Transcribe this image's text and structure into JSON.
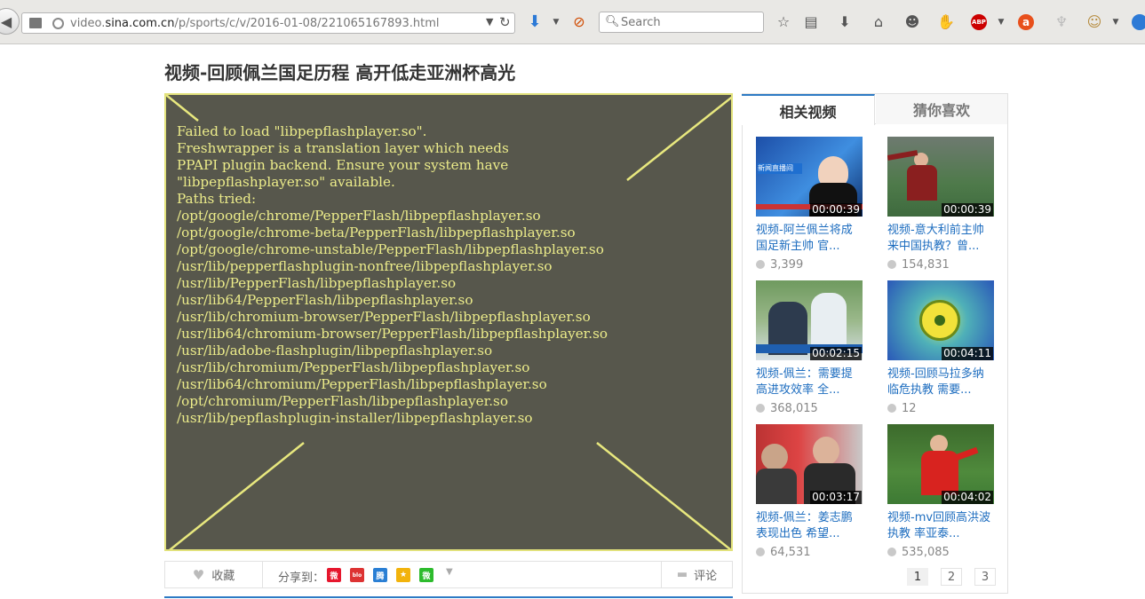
{
  "browser": {
    "url_host_prefix": "video.",
    "url_host_main": "sina.com.cn",
    "url_path": "/p/sports/c/v/2016-01-08/221065167893.html",
    "search_placeholder": "Search"
  },
  "page": {
    "title": "视频-回顾佩兰国足历程 高开低走亚洲杯高光"
  },
  "player": {
    "error_lines": [
      "Failed to load \"libpepflashplayer.so\".",
      "Freshwrapper is a translation layer which needs",
      "PPAPI plugin backend. Ensure your system have",
      "\"libpepflashplayer.so\" available.",
      "Paths tried:",
      "/opt/google/chrome/PepperFlash/libpepflashplayer.so",
      "/opt/google/chrome-beta/PepperFlash/libpepflashplayer.so",
      "/opt/google/chrome-unstable/PepperFlash/libpepflashplayer.so",
      "/usr/lib/pepperflashplugin-nonfree/libpepflashplayer.so",
      "/usr/lib/PepperFlash/libpepflashplayer.so",
      "/usr/lib64/PepperFlash/libpepflashplayer.so",
      "/usr/lib/chromium-browser/PepperFlash/libpepflashplayer.so",
      "/usr/lib64/chromium-browser/PepperFlash/libpepflashplayer.so",
      "/usr/lib/adobe-flashplugin/libpepflashplayer.so",
      "/usr/lib/chromium/PepperFlash/libpepflashplayer.so",
      "/usr/lib64/chromium/PepperFlash/libpepflashplayer.so",
      "/opt/chromium/PepperFlash/libpepflashplayer.so",
      "/usr/lib/pepflashplugin-installer/libpepflashplayer.so"
    ]
  },
  "actions": {
    "favorite_label": "收藏",
    "share_label": "分享到：",
    "share_targets": [
      {
        "name": "weibo",
        "glyph": "微",
        "color": "#e6162d"
      },
      {
        "name": "blog",
        "glyph": "blog",
        "color": "#d33"
      },
      {
        "name": "tencent-weibo",
        "glyph": "腾",
        "color": "#2a7fd4"
      },
      {
        "name": "qzone",
        "glyph": "★",
        "color": "#f2b30c"
      },
      {
        "name": "wechat",
        "glyph": "微",
        "color": "#2dbb2d"
      }
    ],
    "comment_label": "评论"
  },
  "sidebar": {
    "tabs": [
      {
        "label": "相关视频",
        "active": true
      },
      {
        "label": "猜你喜欢",
        "active": false
      }
    ],
    "videos": [
      {
        "title_line1": "视频-阿兰佩兰将成",
        "title_line2": "国足新主帅 官...",
        "duration": "00:00:39",
        "plays": "3,399",
        "thumb": "news"
      },
      {
        "title_line1": "视频-意大利前主帅",
        "title_line2": "来中国执教？曾...",
        "duration": "00:00:39",
        "plays": "154,831",
        "thumb": "coach"
      },
      {
        "title_line1": "视频-佩兰：需要提",
        "title_line2": "高进攻效率 全...",
        "duration": "00:02:15",
        "plays": "368,015",
        "thumb": "players"
      },
      {
        "title_line1": "视频-回顾马拉多纳",
        "title_line2": "临危执教 需要...",
        "duration": "00:04:11",
        "plays": "12",
        "thumb": "reel"
      },
      {
        "title_line1": "视频-佩兰：姜志鹏",
        "title_line2": "表现出色 希望...",
        "duration": "00:03:17",
        "plays": "64,531",
        "thumb": "interview"
      },
      {
        "title_line1": "视频-mv回顾高洪波",
        "title_line2": "执教 率亚泰...",
        "duration": "00:04:02",
        "plays": "535,085",
        "thumb": "redplayer"
      }
    ],
    "pages": [
      "1",
      "2",
      "3"
    ],
    "current_page": "1"
  }
}
